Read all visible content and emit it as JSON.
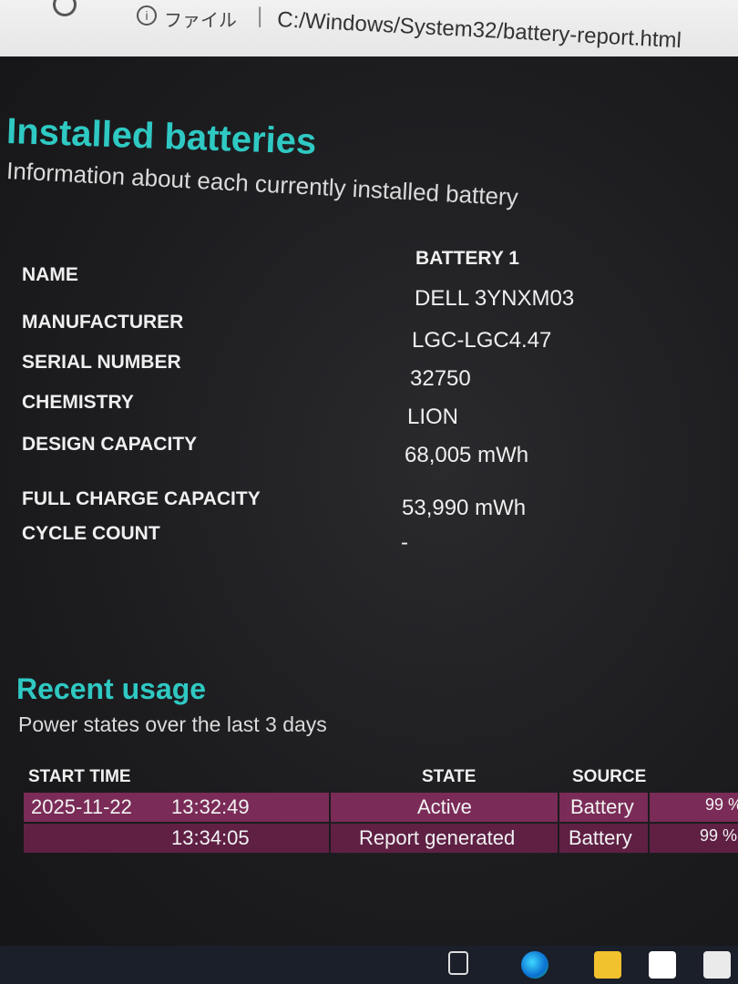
{
  "browser": {
    "file_label": "ファイル",
    "separator": "|",
    "url": "C:/Windows/System32/battery-report.html"
  },
  "installed": {
    "title": "Installed batteries",
    "subtitle": "Information about each currently installed battery",
    "battery_header": "BATTERY 1",
    "rows": [
      {
        "label": "NAME",
        "value": "DELL 3YNXM03"
      },
      {
        "label": "MANUFACTURER",
        "value": "LGC-LGC4.47"
      },
      {
        "label": "SERIAL NUMBER",
        "value": "32750"
      },
      {
        "label": "CHEMISTRY",
        "value": "LION"
      },
      {
        "label": "DESIGN CAPACITY",
        "value": "68,005 mWh"
      },
      {
        "label": "FULL CHARGE CAPACITY",
        "value": "53,990 mWh"
      },
      {
        "label": "CYCLE COUNT",
        "value": "-"
      }
    ]
  },
  "recent": {
    "title": "Recent usage",
    "subtitle": "Power states over the last 3 days",
    "columns": [
      "START TIME",
      "STATE",
      "SOURCE"
    ],
    "rows": [
      {
        "date": "2025-11-22",
        "time": "13:32:49",
        "state": "Active",
        "source": "Battery",
        "capacity": "99 %"
      },
      {
        "date": "",
        "time": "13:34:05",
        "state": "Report generated",
        "source": "Battery",
        "capacity": "99 %"
      }
    ]
  },
  "colors": {
    "heading": "#2fc9c3",
    "row_active": "#7a2b57",
    "row_report": "#5f2044"
  },
  "icons": [
    "reload-icon",
    "info-icon",
    "task-view-icon",
    "edge-icon",
    "file-explorer-icon",
    "store-icon",
    "mail-icon"
  ]
}
